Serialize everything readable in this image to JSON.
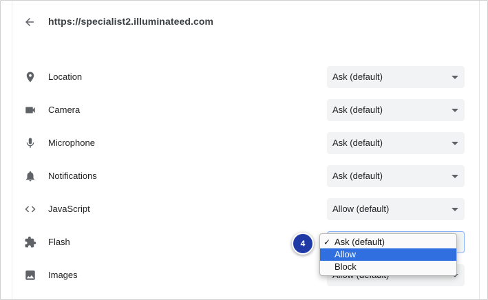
{
  "header": {
    "url": "https://specialist2.illuminateed.com"
  },
  "permissions": [
    {
      "label": "Location",
      "value": "Ask (default)",
      "icon": "location-pin-icon"
    },
    {
      "label": "Camera",
      "value": "Ask (default)",
      "icon": "camera-icon"
    },
    {
      "label": "Microphone",
      "value": "Ask (default)",
      "icon": "microphone-icon"
    },
    {
      "label": "Notifications",
      "value": "Ask (default)",
      "icon": "bell-icon"
    },
    {
      "label": "JavaScript",
      "value": "Allow (default)",
      "icon": "code-brackets-icon"
    },
    {
      "label": "Flash",
      "value": "",
      "icon": "puzzle-piece-icon"
    },
    {
      "label": "Images",
      "value": "Allow (default)",
      "icon": "image-icon"
    }
  ],
  "dropdown": {
    "options": [
      "Ask (default)",
      "Allow",
      "Block"
    ],
    "checked_index": 0,
    "highlighted_index": 1
  },
  "callout": {
    "step_number": "4",
    "color": "#1f3aa6"
  },
  "colors": {
    "select_bg": "#f1f3f4",
    "highlight": "#2f6fdf",
    "icon": "#5f6368"
  }
}
